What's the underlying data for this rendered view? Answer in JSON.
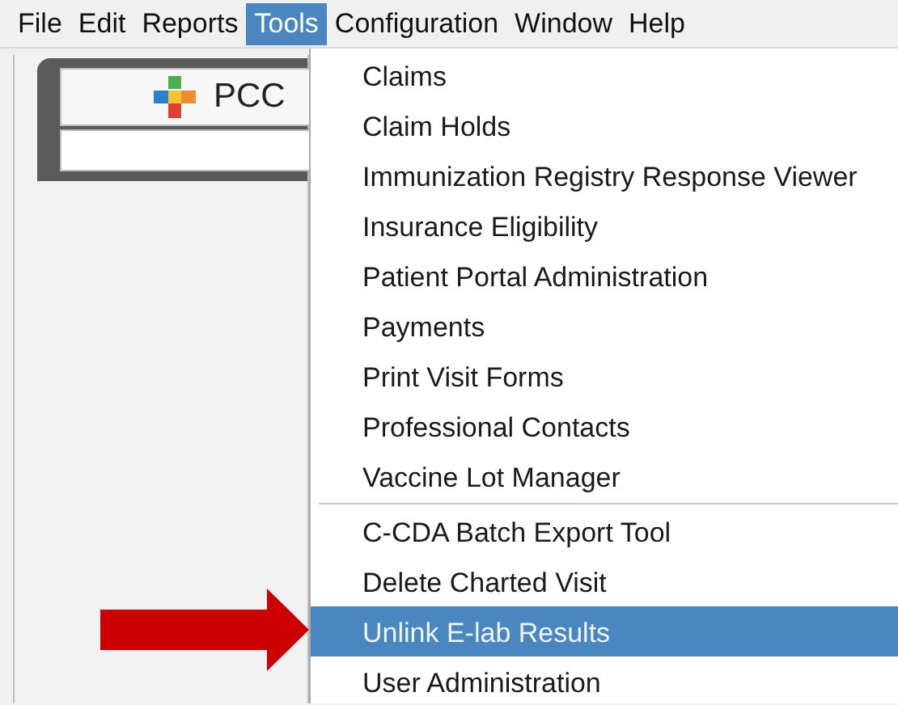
{
  "menubar": [
    {
      "label": "File",
      "selected": false
    },
    {
      "label": "Edit",
      "selected": false
    },
    {
      "label": "Reports",
      "selected": false
    },
    {
      "label": "Tools",
      "selected": true
    },
    {
      "label": "Configuration",
      "selected": false
    },
    {
      "label": "Window",
      "selected": false
    },
    {
      "label": "Help",
      "selected": false
    }
  ],
  "launcher": {
    "title": "PCC"
  },
  "tools_menu": [
    {
      "kind": "item",
      "label": "Claims",
      "selected": false
    },
    {
      "kind": "item",
      "label": "Claim Holds",
      "selected": false
    },
    {
      "kind": "item",
      "label": "Immunization Registry Response Viewer",
      "selected": false
    },
    {
      "kind": "item",
      "label": "Insurance Eligibility",
      "selected": false
    },
    {
      "kind": "item",
      "label": "Patient Portal Administration",
      "selected": false
    },
    {
      "kind": "item",
      "label": "Payments",
      "selected": false
    },
    {
      "kind": "item",
      "label": "Print Visit Forms",
      "selected": false
    },
    {
      "kind": "item",
      "label": "Professional Contacts",
      "selected": false
    },
    {
      "kind": "item",
      "label": "Vaccine Lot Manager",
      "selected": false
    },
    {
      "kind": "separator"
    },
    {
      "kind": "item",
      "label": "C-CDA Batch Export Tool",
      "selected": false
    },
    {
      "kind": "item",
      "label": "Delete Charted Visit",
      "selected": false
    },
    {
      "kind": "item",
      "label": "Unlink E-lab Results",
      "selected": true
    },
    {
      "kind": "item",
      "label": "User Administration",
      "selected": false
    }
  ]
}
